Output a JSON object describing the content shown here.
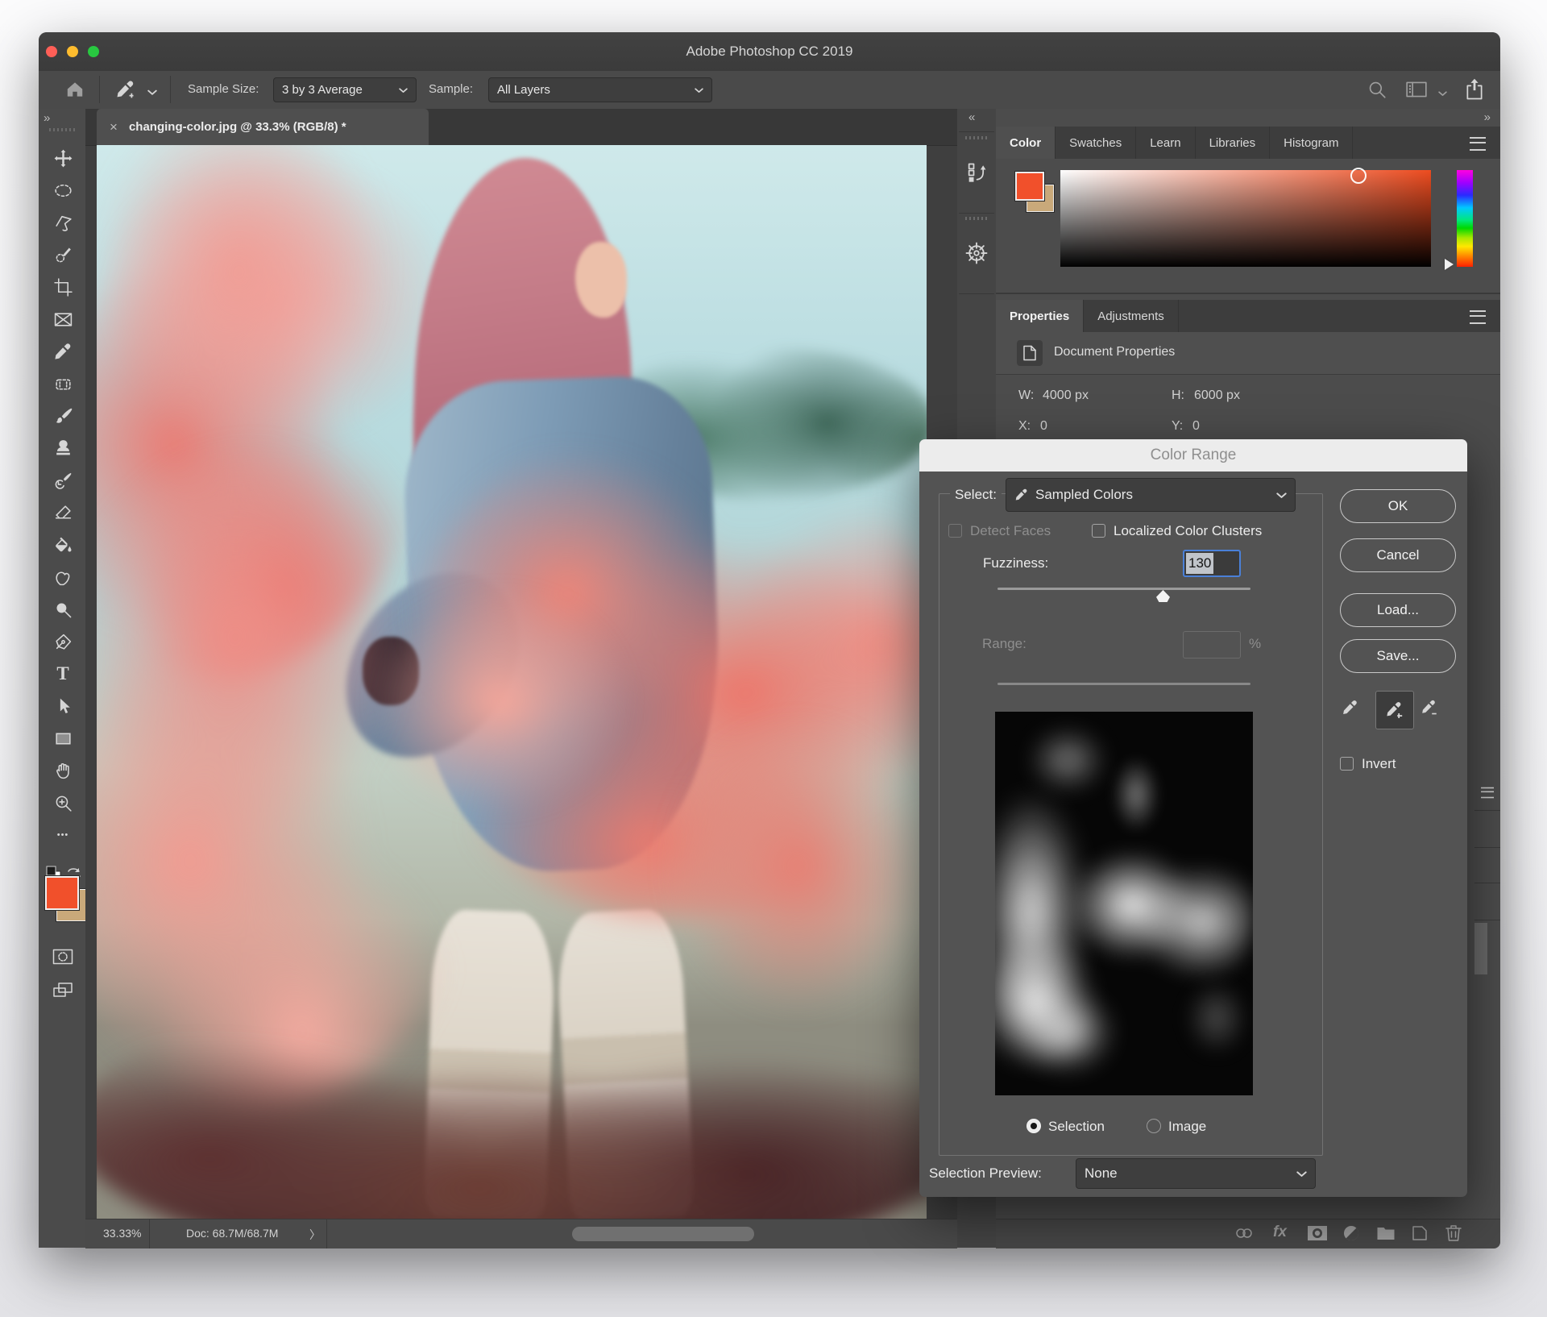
{
  "window": {
    "title": "Adobe Photoshop CC 2019"
  },
  "chrome": {
    "collapse_left": "«",
    "collapse_right": "»",
    "toolbar_expand": "»"
  },
  "options_bar": {
    "sample_size_label": "Sample Size:",
    "sample_size_value": "3 by 3 Average",
    "sample_label": "Sample:",
    "sample_value": "All Layers"
  },
  "document_tab": {
    "close": "×",
    "title": "changing-color.jpg @ 33.3% (RGB/8) *"
  },
  "toolbar": {
    "tools": [
      "move",
      "marquee",
      "lasso",
      "quick-selection",
      "crop",
      "frame",
      "eyedropper",
      "healing-patch",
      "brush",
      "clone-stamp",
      "history-brush",
      "eraser",
      "paint-bucket",
      "smudge",
      "dodge",
      "pen",
      "type",
      "path-selection",
      "rectangle",
      "hand",
      "zoom",
      "more-tools"
    ],
    "type_glyph": "T",
    "more_glyph": "•••"
  },
  "panel_tabs": {
    "color": "Color",
    "swatches": "Swatches",
    "learn": "Learn",
    "libraries": "Libraries",
    "histogram": "Histogram"
  },
  "properties_panel": {
    "tab_properties": "Properties",
    "tab_adjustments": "Adjustments",
    "document_properties": "Document Properties",
    "w_label": "W:",
    "w_value": "4000 px",
    "h_label": "H:",
    "h_value": "6000 px",
    "x_label": "X:",
    "x_value": "0",
    "y_label": "Y:",
    "y_value": "0"
  },
  "color_range_dialog": {
    "title": "Color Range",
    "select_label": "Select:",
    "select_value": "Sampled Colors",
    "detect_faces_label": "Detect Faces",
    "localized_label": "Localized Color Clusters",
    "fuzziness_label": "Fuzziness:",
    "fuzziness_value": "130",
    "range_label": "Range:",
    "percent_sign": "%",
    "ok_label": "OK",
    "cancel_label": "Cancel",
    "load_label": "Load...",
    "save_label": "Save...",
    "invert_label": "Invert",
    "selection_radio_label": "Selection",
    "image_radio_label": "Image",
    "selection_preview_label": "Selection Preview:",
    "selection_preview_value": "None"
  },
  "layers_footer": {
    "fx_label": "fx"
  },
  "status_bar": {
    "zoom_level": "33.33%",
    "doc_size": "Doc: 68.7M/68.7M",
    "chevron": "〉"
  },
  "colors": {
    "foreground_swatch": "#f1502b",
    "background_swatch": "#c9a97a",
    "selection_border_blue": "#4a80d8",
    "traffic_close": "#ff5f57",
    "traffic_min": "#febc2e",
    "traffic_max": "#28c840"
  }
}
